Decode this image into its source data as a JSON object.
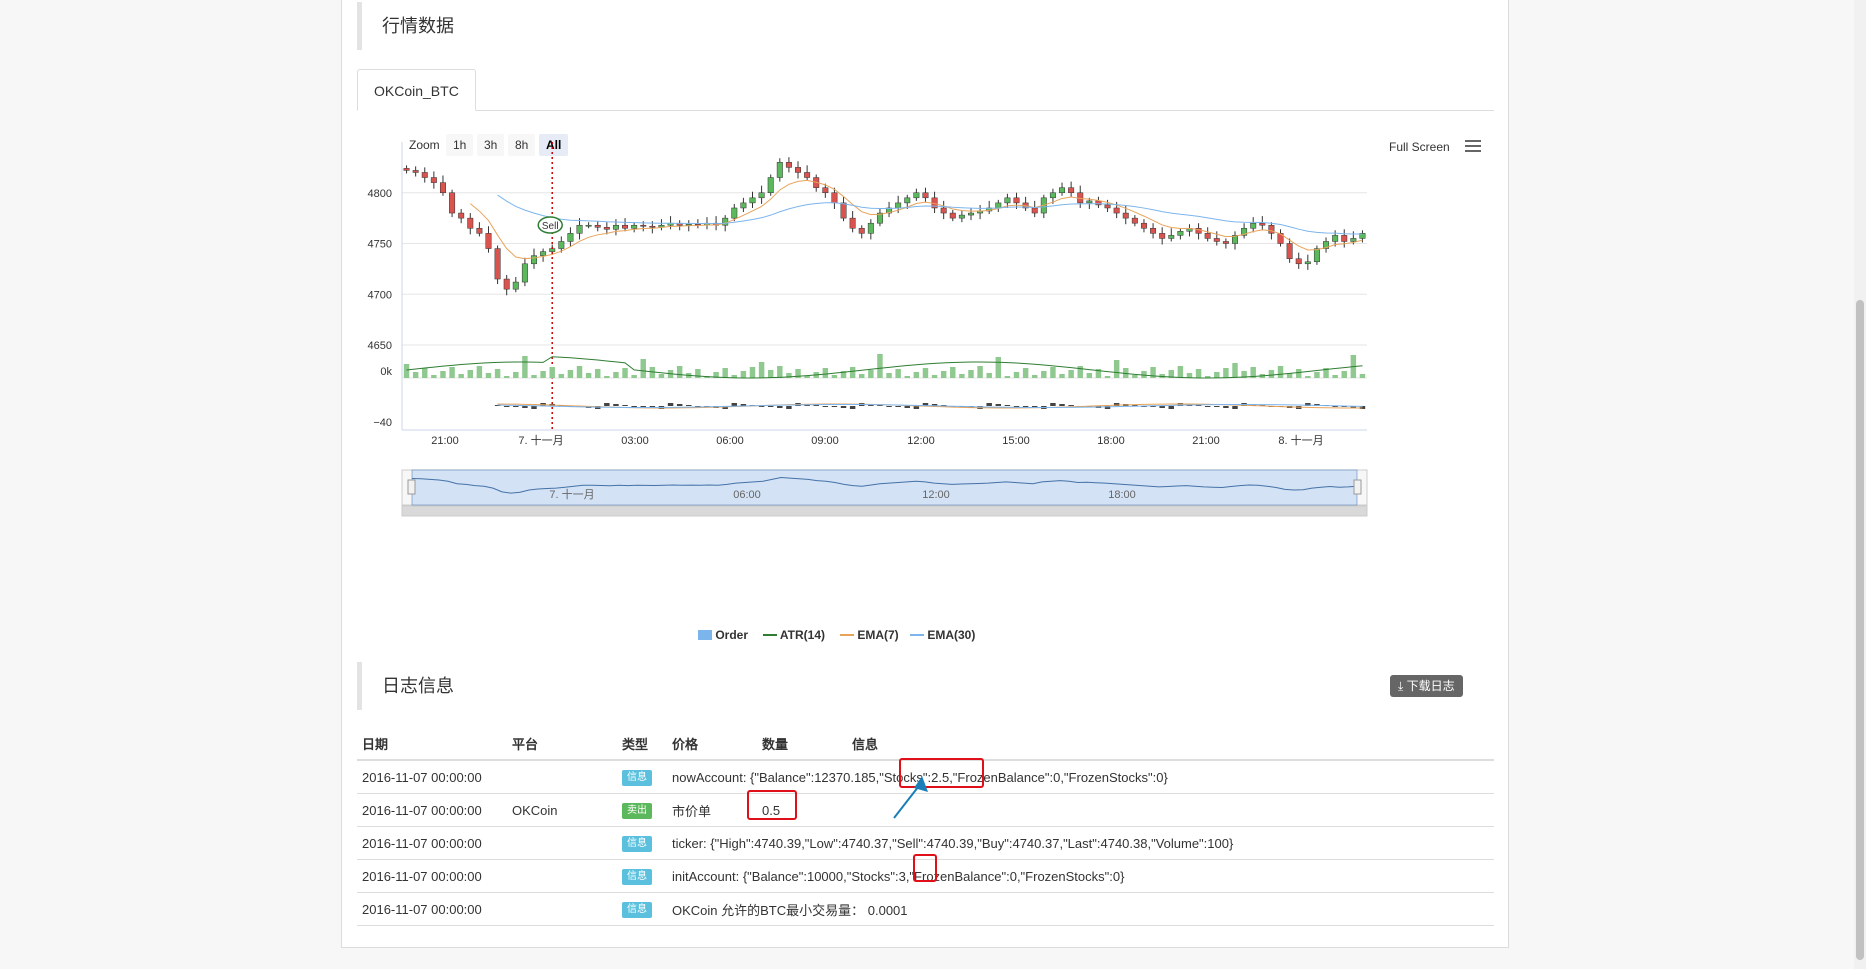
{
  "market": {
    "title": "行情数据",
    "tab": "OKCoin_BTC"
  },
  "toolbar": {
    "zoom_label": "Zoom",
    "zoom_options": [
      "1h",
      "3h",
      "8h",
      "All"
    ],
    "active_zoom": "All",
    "fullscreen_label": "Full Screen"
  },
  "chart_data": {
    "type": "candlestick",
    "y_ticks": [
      "4800",
      "4750",
      "4700",
      "4650"
    ],
    "ylim": [
      4650,
      4850
    ],
    "volume_tick": "0k",
    "macd_tick": "−40",
    "x_ticks": [
      "21:00",
      "7. 十一月",
      "03:00",
      "06:00",
      "09:00",
      "12:00",
      "15:00",
      "18:00",
      "21:00",
      "8. 十一月"
    ],
    "navigator_ticks": [
      "7. 十一月",
      "06:00",
      "12:00",
      "18:00"
    ],
    "flag_label": "Sell",
    "legend": [
      "Order",
      "ATR(14)",
      "EMA(7)",
      "EMA(30)"
    ],
    "colors": {
      "up": "#5cb85c",
      "down": "#d9534f",
      "ema7": "#e8a35a",
      "ema30": "#7cb5ec",
      "atr": "#2e7d32",
      "navigator": "#4572a7"
    },
    "closes": [
      4822,
      4820,
      4815,
      4810,
      4800,
      4780,
      4775,
      4765,
      4760,
      4745,
      4715,
      4705,
      4712,
      4730,
      4738,
      4742,
      4745,
      4752,
      4760,
      4768,
      4768,
      4766,
      4764,
      4768,
      4765,
      4768,
      4767,
      4766,
      4768,
      4770,
      4768,
      4769,
      4768,
      4770,
      4768,
      4775,
      4785,
      4790,
      4795,
      4800,
      4815,
      4830,
      4825,
      4820,
      4815,
      4805,
      4800,
      4790,
      4775,
      4765,
      4760,
      4770,
      4780,
      4785,
      4790,
      4795,
      4800,
      4795,
      4785,
      4780,
      4775,
      4778,
      4780,
      4782,
      4785,
      4790,
      4795,
      4790,
      4785,
      4780,
      4795,
      4800,
      4805,
      4800,
      4790,
      4792,
      4788,
      4785,
      4780,
      4775,
      4770,
      4765,
      4760,
      4755,
      4758,
      4762,
      4765,
      4760,
      4755,
      4752,
      4750,
      4758,
      4765,
      4770,
      4768,
      4760,
      4750,
      4735,
      4730,
      4732,
      4745,
      4752,
      4758,
      4752,
      4755,
      4760
    ]
  },
  "log": {
    "title": "日志信息",
    "download_label": "下载日志",
    "headers": [
      "日期",
      "平台",
      "类型",
      "价格",
      "数量",
      "信息"
    ],
    "rows": [
      {
        "date": "2016-11-07 00:00:00",
        "platform": "",
        "type": "信息",
        "price": "nowAccount: {\"Balance\":12370.185,\"Stocks\":2.5,\"FrozenBalance\":0,\"FrozenStocks\":0}",
        "qty": "",
        "info": ""
      },
      {
        "date": "2016-11-07 00:00:00",
        "platform": "OKCoin",
        "type": "卖出",
        "price": "市价单",
        "qty": "0.5",
        "info": ""
      },
      {
        "date": "2016-11-07 00:00:00",
        "platform": "",
        "type": "信息",
        "price": "ticker: {\"High\":4740.39,\"Low\":4740.37,\"Sell\":4740.39,\"Buy\":4740.37,\"Last\":4740.38,\"Volume\":100}",
        "qty": "",
        "info": ""
      },
      {
        "date": "2016-11-07 00:00:00",
        "platform": "",
        "type": "信息",
        "price": "initAccount: {\"Balance\":10000,\"Stocks\":3,\"FrozenBalance\":0,\"FrozenStocks\":0}",
        "qty": "",
        "info": ""
      },
      {
        "date": "2016-11-07 00:00:00",
        "platform": "",
        "type": "信息",
        "price": "OKCoin 允许的BTC最小交易量： 0.0001",
        "qty": "",
        "info": ""
      }
    ]
  }
}
